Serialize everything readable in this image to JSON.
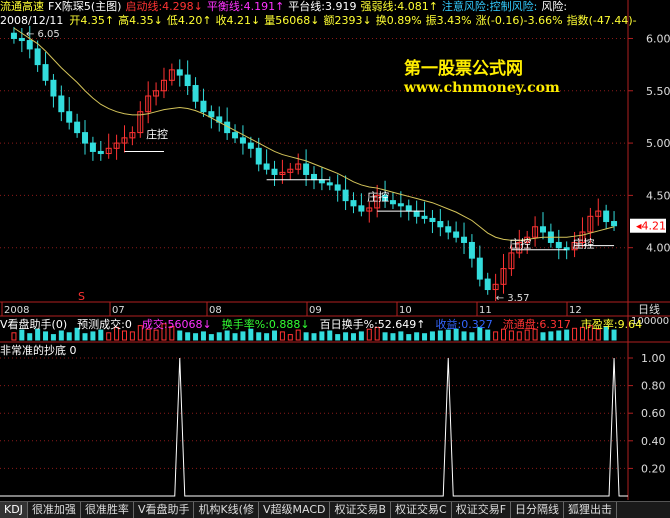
{
  "header1": {
    "stock": "流通高速",
    "formula": "FX陈琛5(主图)",
    "items": [
      {
        "label": "启动线:",
        "value": "4.298",
        "color": "#ff3333",
        "arrow": "↓"
      },
      {
        "label": "平衡线:",
        "value": "4.191",
        "color": "#ff33ff",
        "arrow": "↑"
      },
      {
        "label": "平台线:",
        "value": "3.919",
        "color": "#ffffff",
        "arrow": ""
      },
      {
        "label": "强弱线:",
        "value": "4.081",
        "color": "#ffff33",
        "arrow": "↑"
      },
      {
        "label": "注意风险:",
        "value": "控制风险:",
        "color": "#33ccff",
        "arrow": ""
      },
      {
        "label": "风险:",
        "value": "",
        "color": "#ffffff",
        "arrow": ""
      }
    ]
  },
  "header2": {
    "date": "2008/12/11",
    "open": "开4.35↑",
    "high": "高4.35↓",
    "low": "低4.20↑",
    "close": "收4.21↓",
    "volume": "量56068↓",
    "amount": "额2393↓",
    "turnover": "换0.89%",
    "amplitude": "振3.43%",
    "change": "涨(-0.16)-3.66%",
    "index": "指数(-47.44)-"
  },
  "brand": {
    "title": "第一股票公式网",
    "url": "www.chnmoney.com"
  },
  "price_axis": [
    "6.00",
    "5.50",
    "5.00",
    "4.50",
    "4.00"
  ],
  "current_price": "4.21",
  "peak_label": "6.05",
  "trough_label": "3.57",
  "control_labels": [
    "庄控",
    "庄控",
    "庄控",
    "庄控"
  ],
  "date_axis": [
    "2008",
    "07",
    "08",
    "09",
    "10",
    "11",
    "12"
  ],
  "date_axis_unit": "日线",
  "marker": "S",
  "volume_header": {
    "title": "V看盘助手(0)",
    "items": [
      {
        "text": "预测成交:0",
        "color": "#ffffff"
      },
      {
        "text": "成交:56068↓",
        "color": "#ff33ff"
      },
      {
        "text": "换手率%:0.888↓",
        "color": "#33ff33"
      },
      {
        "text": "百日换手%:52.649↑",
        "color": "#ffffff"
      },
      {
        "text": "收益:0.327",
        "color": "#3366ff"
      },
      {
        "text": "流通盘:6.317",
        "color": "#ff3333"
      },
      {
        "text": "市盈率:9.64",
        "color": "#ffff33"
      }
    ]
  },
  "volume_axis": [
    "100000"
  ],
  "indicator_header": {
    "title": "非常准的抄底 0"
  },
  "indicator_axis": [
    "1.00",
    "0.80",
    "0.60",
    "0.40",
    "0.20"
  ],
  "tabs": [
    "KDJ",
    "很准加强",
    "很准胜率",
    "V看盘助手",
    "机构K线(修",
    "V超级MACD",
    "权证交易B",
    "权证交易C",
    "权证交易F",
    "日分隔线",
    "狐狸出击"
  ],
  "colors": {
    "up": "#ff3333",
    "down": "#33dddd",
    "ma": "#d4c45a",
    "grid": "#8b1a1a",
    "axis": "#b02020"
  },
  "chart_data": {
    "type": "candlestick",
    "ylim": [
      3.5,
      6.1
    ],
    "close": [
      6.0,
      5.98,
      5.9,
      5.75,
      5.6,
      5.45,
      5.3,
      5.2,
      5.1,
      5.0,
      4.92,
      4.9,
      4.95,
      5.0,
      5.05,
      5.1,
      5.3,
      5.45,
      5.5,
      5.6,
      5.7,
      5.65,
      5.55,
      5.4,
      5.3,
      5.25,
      5.2,
      5.1,
      5.05,
      5.0,
      4.95,
      4.8,
      4.75,
      4.7,
      4.72,
      4.75,
      4.8,
      4.7,
      4.65,
      4.62,
      4.6,
      4.55,
      4.45,
      4.4,
      4.35,
      4.38,
      4.5,
      4.45,
      4.42,
      4.4,
      4.35,
      4.3,
      4.28,
      4.25,
      4.2,
      4.15,
      4.1,
      4.05,
      3.9,
      3.7,
      3.6,
      3.65,
      3.8,
      3.95,
      4.05,
      4.1,
      4.2,
      4.15,
      4.05,
      4.0,
      3.98,
      4.05,
      4.15,
      4.3,
      4.35,
      4.25,
      4.21
    ],
    "ma": [
      6.1,
      6.05,
      6.0,
      5.95,
      5.88,
      5.8,
      5.72,
      5.65,
      5.58,
      5.5,
      5.43,
      5.37,
      5.33,
      5.3,
      5.28,
      5.27,
      5.27,
      5.28,
      5.3,
      5.32,
      5.33,
      5.34,
      5.33,
      5.31,
      5.28,
      5.24,
      5.2,
      5.16,
      5.12,
      5.08,
      5.04,
      5.0,
      4.96,
      4.92,
      4.89,
      4.87,
      4.85,
      4.83,
      4.8,
      4.77,
      4.74,
      4.71,
      4.67,
      4.63,
      4.6,
      4.58,
      4.57,
      4.55,
      4.53,
      4.51,
      4.49,
      4.47,
      4.45,
      4.43,
      4.4,
      4.37,
      4.34,
      4.3,
      4.26,
      4.2,
      4.14,
      4.1,
      4.08,
      4.07,
      4.07,
      4.08,
      4.09,
      4.1,
      4.1,
      4.1,
      4.1,
      4.11,
      4.12,
      4.14,
      4.16,
      4.18,
      4.2
    ],
    "volume": [
      40,
      55,
      35,
      60,
      45,
      30,
      50,
      40,
      65,
      35,
      45,
      55,
      40,
      70,
      50,
      45,
      80,
      60,
      55,
      90,
      75,
      50,
      40,
      35,
      45,
      30,
      40,
      50,
      35,
      45,
      60,
      40,
      35,
      50,
      45,
      30,
      55,
      40,
      35,
      45,
      50,
      30,
      40,
      35,
      45,
      60,
      70,
      40,
      35,
      45,
      30,
      40,
      35,
      45,
      50,
      55,
      60,
      45,
      40,
      70,
      55,
      45,
      60,
      50,
      45,
      55,
      60,
      40,
      45,
      50,
      55,
      65,
      70,
      80,
      60,
      75,
      55
    ],
    "signals": [
      21,
      55,
      76
    ]
  }
}
